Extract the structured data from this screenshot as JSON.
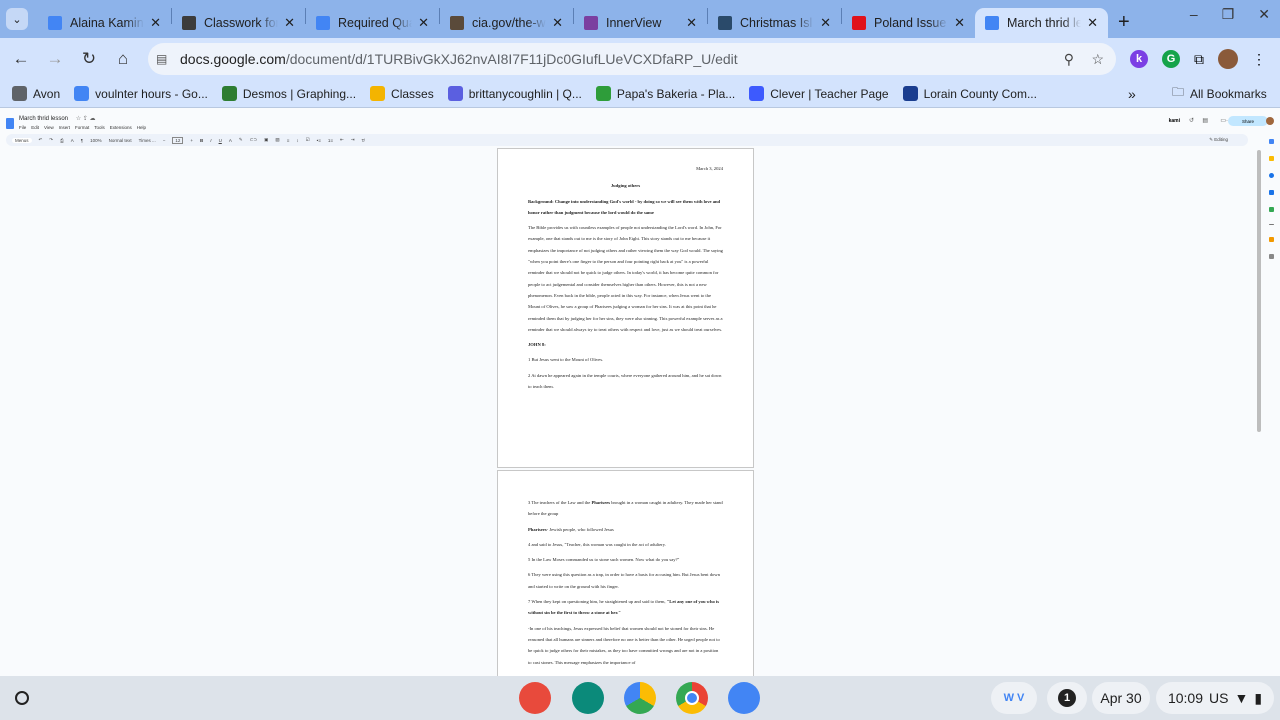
{
  "browser": {
    "tabs": [
      {
        "title": "Alaina Kamin",
        "icon": "google-docs-icon",
        "color": "#4285f4"
      },
      {
        "title": "Classwork for",
        "icon": "google-classroom-icon",
        "color": "#3c3c3c"
      },
      {
        "title": "Required Qua",
        "icon": "google-docs-icon",
        "color": "#4285f4"
      },
      {
        "title": "cia.gov/the-w",
        "icon": "cia-seal-icon",
        "color": "#5a4a3a"
      },
      {
        "title": "InnerView",
        "icon": "innerview-icon",
        "color": "#7b3fa0"
      },
      {
        "title": "Christmas Isl",
        "icon": "christmas-island-icon",
        "color": "#2a4a6a"
      },
      {
        "title": "Poland Issue",
        "icon": "newsela-icon",
        "color": "#e0121b"
      },
      {
        "title": "March thrid le",
        "icon": "google-docs-icon",
        "color": "#4285f4",
        "active": true
      }
    ],
    "url_host": "docs.google.com",
    "url_path": "/document/d/1TURBivGkXJ62nvAI8I7F11jDc0GIufLUeVCXDfaRP_U/edit",
    "bookmarks": [
      {
        "label": "Avon",
        "color": "#5f6368"
      },
      {
        "label": "voulnter hours - Go...",
        "color": "#4285f4"
      },
      {
        "label": "Desmos | Graphing...",
        "color": "#2e7d32"
      },
      {
        "label": "Classes",
        "color": "#f4b400"
      },
      {
        "label": "brittanycoughlin | Q...",
        "color": "#5b5fe0"
      },
      {
        "label": "Papa's Bakeria - Pla...",
        "color": "#2e9d3a"
      },
      {
        "label": "Clever | Teacher Page",
        "color": "#3d5afe"
      },
      {
        "label": "Lorain County Com...",
        "color": "#1a3d8f"
      }
    ],
    "all_bookmarks": "All Bookmarks"
  },
  "docs": {
    "title": "March thrid lesson",
    "menu": [
      "File",
      "Edit",
      "View",
      "Insert",
      "Format",
      "Tools",
      "Extensions",
      "Help"
    ],
    "toolbar": {
      "search": "Menus",
      "zoom": "100%",
      "style": "Normal text",
      "font": "Times ...",
      "font_size": "12",
      "mode": "Editing"
    },
    "kami": "kami",
    "share": "Share"
  },
  "page1": {
    "date": "March 3, 2024",
    "title": "Judging others",
    "background": "Background: Change into understanding God's world - by doing so we will see them with love and honor rather than judgment because the lord would do the same",
    "body": "The Bible provides us with countless examples of people not understanding the Lord's word. In John, For example, one that stands out to me is the story of John Eight. This story stands out to me because it emphasizes the importance of not judging others and rather viewing them the way God would. The saying \"when you point there's one finger to the person and four pointing right back at you\" is a powerful reminder that we should not be quick to judge others. In today's world, it has become quite common for people to act judgemental and consider themselves higher than others. However, this is not a new phenomenon. Even back in the bible, people acted in this way. For instance, when Jesus went to the Mount of Olives, he saw a group of Pharisees judging a woman for her sins. It was at this point that he reminded them that by judging her for her sins, they were also sinning. This powerful example serves as a reminder that we should always try to treat others with respect and love, just as we should treat ourselves.",
    "heading": "JOHN 8:",
    "v1": "1 But Jesus went to the Mount of Olives.",
    "v2": "2 At dawn he appeared again in the temple courts, where everyone gathered around him, and he sat down to teach them."
  },
  "page2": {
    "v3a": "3 The teachers of the Law and the ",
    "v3b": "Pharisees",
    "v3c": " brought in a woman caught in adultery. They made her stand before the group",
    "phar_a": "Pharisees",
    "phar_b": "- Jewish people, who followed Jesus",
    "v4": "4 and said to Jesus, \"Teacher, this woman was caught in the act of adultery.",
    "v5": "5 In the Law Moses commanded us to stone such women. Now what do you say?\"",
    "v6": "6 They were using this question as a trap, in order to have a basis for accusing him. But Jesus bent down and started to write on the ground with his finger.",
    "v7a": "7 When they kept on questioning him, he straightened up and said to them, ",
    "v7b": "\"Let any one of you who is without sin be the first to throw a stone at her.\"",
    "para": "-In one of his teachings, Jesus expressed his belief that women should not be stoned for their sins. He reasoned that all humans are sinners and therefore no one is better than the other. He urged people not to be quick to judge others for their mistakes, as they too have committed wrongs and are not in a position to cast stones. This message emphasizes the importance of"
  },
  "shelf": {
    "date": "Apr 30",
    "time": "10:09",
    "locale": "US",
    "notifications": "1"
  }
}
